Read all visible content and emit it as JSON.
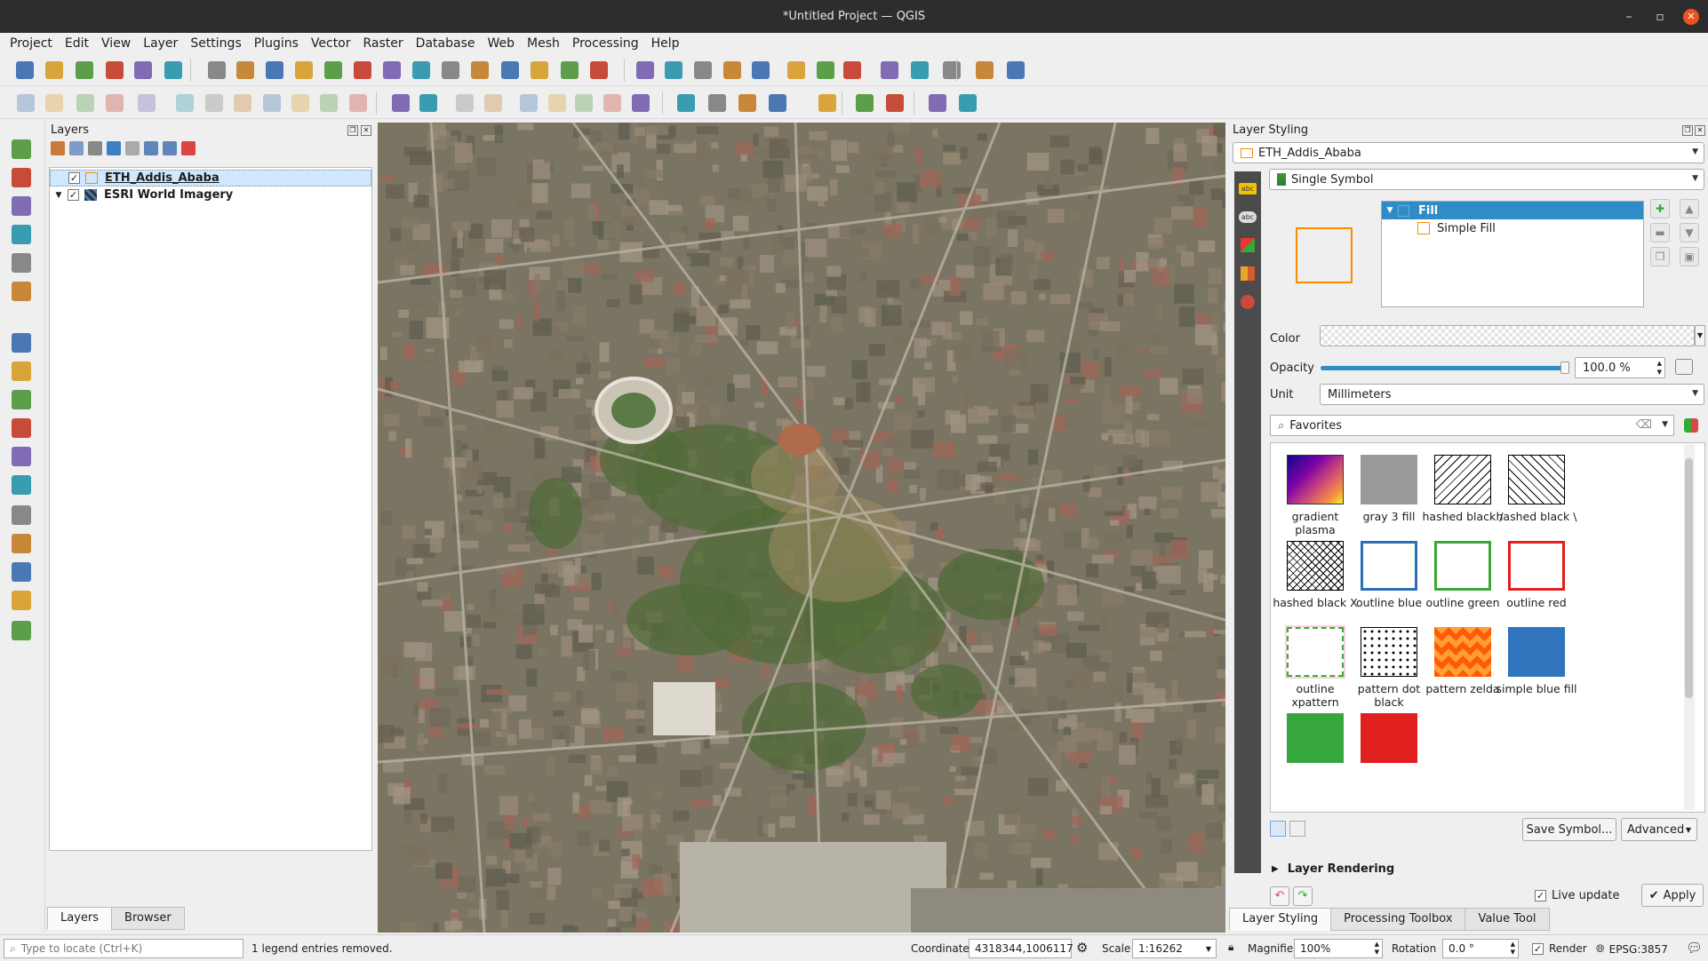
{
  "window": {
    "title": "*Untitled Project — QGIS",
    "close_glyph": "✕"
  },
  "menu": [
    "Project",
    "Edit",
    "View",
    "Layer",
    "Settings",
    "Plugins",
    "Vector",
    "Raster",
    "Database",
    "Web",
    "Mesh",
    "Processing",
    "Help"
  ],
  "layers_panel": {
    "title": "Layers",
    "layers": [
      {
        "name": "ETH_Addis_Ababa",
        "checked": true,
        "selected": true
      },
      {
        "name": "ESRI World Imagery",
        "checked": true,
        "selected": false
      }
    ],
    "tabs": [
      "Layers",
      "Browser"
    ]
  },
  "styling": {
    "title": "Layer Styling",
    "layer_combo": "ETH_Addis_Ababa",
    "renderer_combo": "Single Symbol",
    "tree": {
      "root": "Fill",
      "child": "Simple Fill"
    },
    "color_label": "Color",
    "opacity_label": "Opacity",
    "opacity_value": "100.0 %",
    "opacity_fraction": 1.0,
    "unit_label": "Unit",
    "unit_value": "Millimeters",
    "search_value": "Favorites",
    "symbols": [
      {
        "name": "gradient plasma",
        "style": "gradient"
      },
      {
        "name": "gray 3 fill",
        "style": "gray"
      },
      {
        "name": "hashed black /",
        "style": "hash-fwd"
      },
      {
        "name": "hashed black \\",
        "style": "hash-back"
      },
      {
        "name": "hashed black X",
        "style": "hash-x"
      },
      {
        "name": "outline blue",
        "style": "outline-blue"
      },
      {
        "name": "outline green",
        "style": "outline-green"
      },
      {
        "name": "outline red",
        "style": "outline-red"
      },
      {
        "name": "outline xpattern",
        "style": "xpattern"
      },
      {
        "name": "pattern dot black",
        "style": "dots"
      },
      {
        "name": "pattern zelda",
        "style": "zelda"
      },
      {
        "name": "simple blue fill",
        "style": "blue"
      },
      {
        "name": "",
        "style": "green"
      },
      {
        "name": "",
        "style": "red"
      }
    ],
    "save_symbol": "Save Symbol...",
    "advanced": "Advanced",
    "layer_rendering": "Layer Rendering",
    "live_update": "Live update",
    "live_update_checked": true,
    "apply": "Apply",
    "bottom_tabs": [
      "Layer Styling",
      "Processing Toolbox",
      "Value Tool"
    ]
  },
  "status": {
    "locator_placeholder": "Type to locate (Ctrl+K)",
    "message": "1 legend entries removed.",
    "coordinate_label": "Coordinate",
    "coordinate_value": "4318344,1006117",
    "scale_label": "Scale",
    "scale_value": "1:16262",
    "magnifier_label": "Magnifier",
    "magnifier_value": "100%",
    "rotation_label": "Rotation",
    "rotation_value": "0.0 °",
    "render_label": "Render",
    "render_checked": true,
    "crs": "EPSG:3857"
  },
  "colors": {
    "accent": "#308cc6",
    "selection": "#cde8ff",
    "fill_orange": "#ff8a00"
  }
}
